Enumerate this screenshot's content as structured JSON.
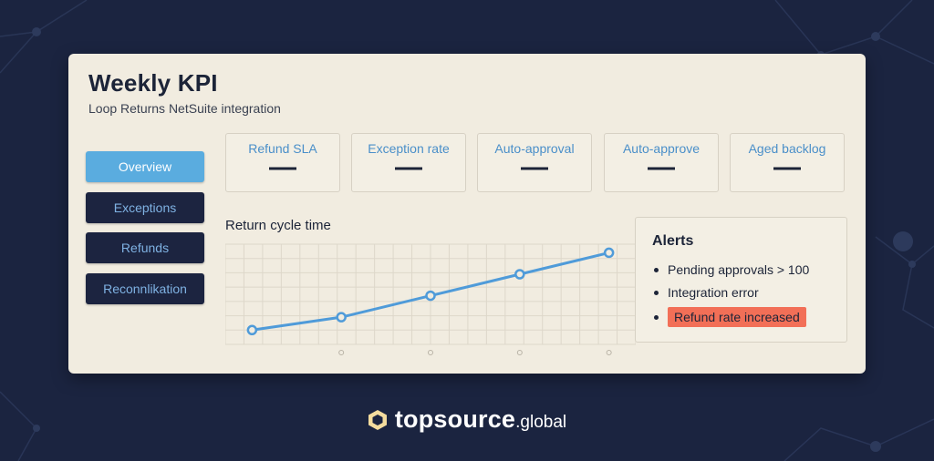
{
  "header": {
    "title": "Weekly KPI",
    "subtitle": "Loop Returns NetSuite integration"
  },
  "nav": {
    "items": [
      {
        "label": "Overview",
        "active": true
      },
      {
        "label": "Exceptions",
        "active": false
      },
      {
        "label": "Refunds",
        "active": false
      },
      {
        "label": "Reconnlikation",
        "active": false
      }
    ]
  },
  "kpis": [
    {
      "label": "Refund SLA",
      "value": "—"
    },
    {
      "label": "Exception rate",
      "value": "—"
    },
    {
      "label": "Auto-approval",
      "value": "—"
    },
    {
      "label": "Auto-approve",
      "value": "—"
    },
    {
      "label": "Aged backlog",
      "value": "—"
    }
  ],
  "chart_data": {
    "type": "line",
    "title": "Return cycle time",
    "x": [
      1,
      2,
      3,
      4,
      5
    ],
    "series": [
      {
        "values": [
          1.0,
          1.9,
          3.4,
          4.9,
          6.4
        ]
      }
    ],
    "ylim": [
      0,
      7
    ],
    "grid": true,
    "line_color": "#4f9bd9"
  },
  "alerts": {
    "title": "Alerts",
    "items": [
      {
        "text": "Pending approvals > 100",
        "highlight": false
      },
      {
        "text": "Integration error",
        "highlight": false
      },
      {
        "text": "Refund rate increased",
        "highlight": true
      }
    ]
  },
  "branding": {
    "name": "topsource",
    "suffix": ".global",
    "icon": "hexagon-logo-icon"
  },
  "colors": {
    "background": "#1b2440",
    "accent": "#5aacdf",
    "alert": "#f26f57"
  }
}
